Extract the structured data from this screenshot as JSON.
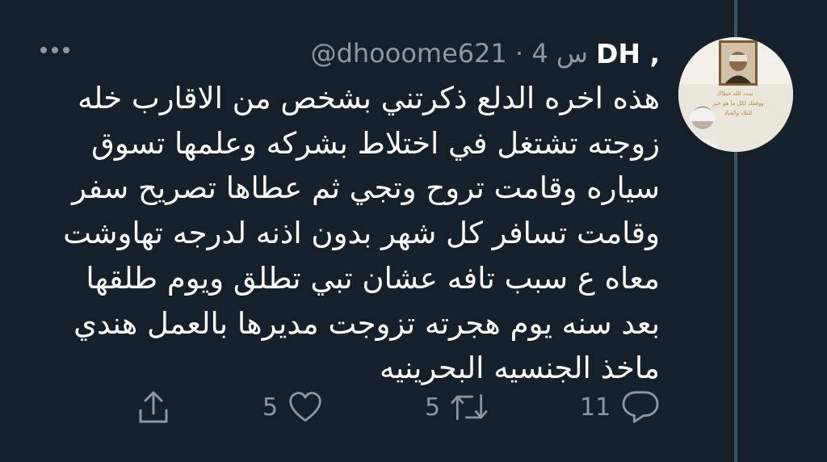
{
  "tweet": {
    "display_name": "DH ,",
    "handle_meta": "@dhooome621 · 4 س",
    "text": "هذه اخره الدلع ذكرتني بشخص من الاقارب خله\nزوجته تشتغل في اختلاط بشركه وعلمها تسوق\nسياره وقامت تروح وتجي ثم عطاها تصريح سفر\nوقامت تسافر كل شهر بدون اذنه لدرجه تهاوشت\nمعاه ع سبب تافه عشان تبي تطلق ويوم طلقها\nبعد سنه يوم هجرته تزوجت مديرها بالعمل هندي\nماخذ الجنسيه البحرينيه",
    "replies": "11",
    "retweets": "5",
    "likes": "5"
  },
  "avatar": {
    "banner_text_1": "سدد الله خطاك",
    "banner_text_2": "ووفقك لكل ما هو خير",
    "banner_text_3": "للبلاد والعباد"
  },
  "icons": [
    "more-icon",
    "reply-icon",
    "retweet-icon",
    "like-icon",
    "share-icon"
  ],
  "colors": {
    "background": "#15202b",
    "text": "#ffffff",
    "secondary": "#8899a6",
    "thread_line": "#3d5466"
  }
}
